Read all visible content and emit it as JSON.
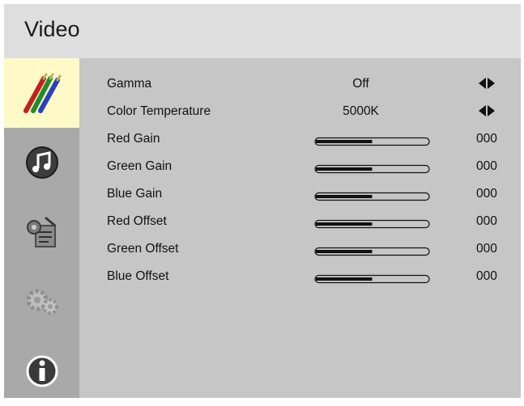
{
  "header": {
    "title": "Video"
  },
  "sidebar": {
    "items": [
      {
        "name": "video",
        "icon": "paintbrushes-icon",
        "active": true
      },
      {
        "name": "audio",
        "icon": "music-note-icon",
        "active": false
      },
      {
        "name": "setup",
        "icon": "setup-tools-icon",
        "active": false
      },
      {
        "name": "advanced",
        "icon": "gears-icon",
        "active": false
      },
      {
        "name": "info",
        "icon": "info-icon",
        "active": false
      }
    ]
  },
  "settings": {
    "gamma": {
      "label": "Gamma",
      "value": "Off"
    },
    "color_temperature": {
      "label": "Color Temperature",
      "value": "5000K"
    },
    "sliders": [
      {
        "label": "Red Gain",
        "value": "000",
        "level": 0.5
      },
      {
        "label": "Green Gain",
        "value": "000",
        "level": 0.5
      },
      {
        "label": "Blue Gain",
        "value": "000",
        "level": 0.5
      },
      {
        "label": "Red Offset",
        "value": "000",
        "level": 0.5
      },
      {
        "label": "Green Offset",
        "value": "000",
        "level": 0.5
      },
      {
        "label": "Blue Offset",
        "value": "000",
        "level": 0.5
      }
    ]
  },
  "colors": {
    "header_bg": "#dedede",
    "panel_bg": "#c6c6c6",
    "sidebar_bg": "#a9a9a9",
    "active_item_bg": "#fdfac8"
  }
}
